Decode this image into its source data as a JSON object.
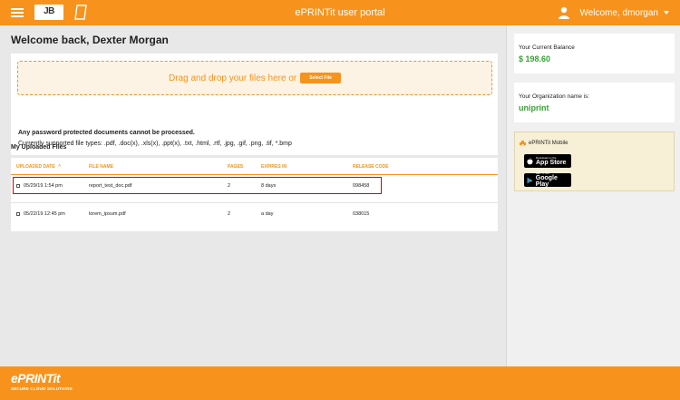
{
  "header": {
    "logo_text": "JB",
    "title": "ePRINTit user portal",
    "user_label": "Welcome, dmorgan",
    "icons": [
      "menu-icon",
      "document-icon",
      "user-icon",
      "chevron-down-icon"
    ]
  },
  "main": {
    "welcome": "Welcome back, Dexter Morgan",
    "dropzone_text": "Drag and drop your files here or",
    "select_button": "Select File",
    "note_bold": "Any password protected documents cannot be processed.",
    "note_types": "Currently supported file types: .pdf, .doc(x), .xls(x), .ppt(x), .txt, .html, .rtf, .jpg, .gif, .png, .tif, *.bmp"
  },
  "files": {
    "title": "My Uploaded Files",
    "columns": {
      "uploaded": "UPLOADED DATE",
      "name": "FILE NAME",
      "pages": "PAGES",
      "expires": "EXPIRES IN",
      "code": "RELEASE CODE"
    },
    "sort_indicator": "^",
    "rows": [
      {
        "date": "05/29/19 1:54 pm",
        "name": "report_test_doc.pdf",
        "pages": "2",
        "expires": "8 days",
        "code": "098458"
      },
      {
        "date": "05/22/19 12:45 pm",
        "name": "lorem_ipsum.pdf",
        "pages": "2",
        "expires": "a day",
        "code": "038015"
      }
    ]
  },
  "sidebar": {
    "balance_label": "Your Current Balance",
    "balance_value": "$ 198.60",
    "org_label": "Your Organization name is:",
    "org_value": "uniprint",
    "mobile_title": "ePRINTit Mobile",
    "app_store_small": "Download on the",
    "app_store_big": "App Store",
    "google_small": "GET IT ON",
    "google_big": "Google Play"
  },
  "footer": {
    "logo": "ePRINTit",
    "tagline": "SECURE CLOUD SOLUTIONS"
  },
  "colors": {
    "brand": "#f7931d",
    "positive": "#3aa036",
    "highlight": "#e00000"
  }
}
